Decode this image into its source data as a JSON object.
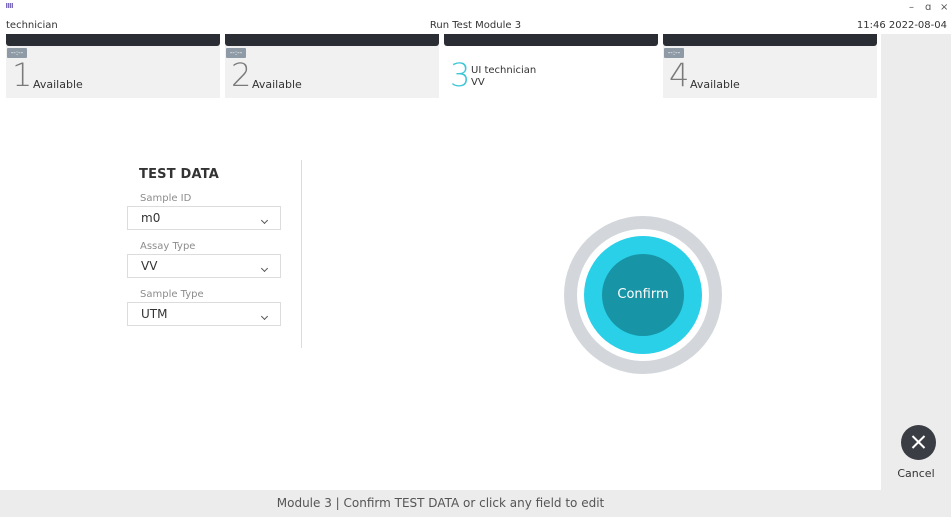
{
  "titlebar": {
    "user": "technician",
    "title": "Run Test Module 3",
    "datetime": "11:46 2022-08-04",
    "minimize_glyph": "–",
    "maximize_glyph": "ɑ",
    "close_glyph": "×"
  },
  "tabs": [
    {
      "number": "1",
      "badge": "--:--",
      "status": "Available"
    },
    {
      "number": "2",
      "badge": "--:--",
      "status": "Available"
    },
    {
      "number": "3",
      "user": "UI technician",
      "assay": "VV",
      "active": true
    },
    {
      "number": "4",
      "badge": "--:--",
      "status": "Available"
    }
  ],
  "form": {
    "heading": "TEST DATA",
    "fields": [
      {
        "label": "Sample ID",
        "value": "m0"
      },
      {
        "label": "Assay Type",
        "value": "VV"
      },
      {
        "label": "Sample Type",
        "value": "UTM"
      }
    ]
  },
  "confirm": {
    "label": "Confirm"
  },
  "cancel": {
    "label": "Cancel",
    "icon": "close-icon"
  },
  "status_bar": {
    "text": "Module 3  |  Confirm TEST DATA or click any field to edit"
  },
  "colors": {
    "accent": "#2ad0e8",
    "confirm": "#1794a6",
    "tab_bar": "#2a2d33",
    "panel": "#ececec"
  }
}
